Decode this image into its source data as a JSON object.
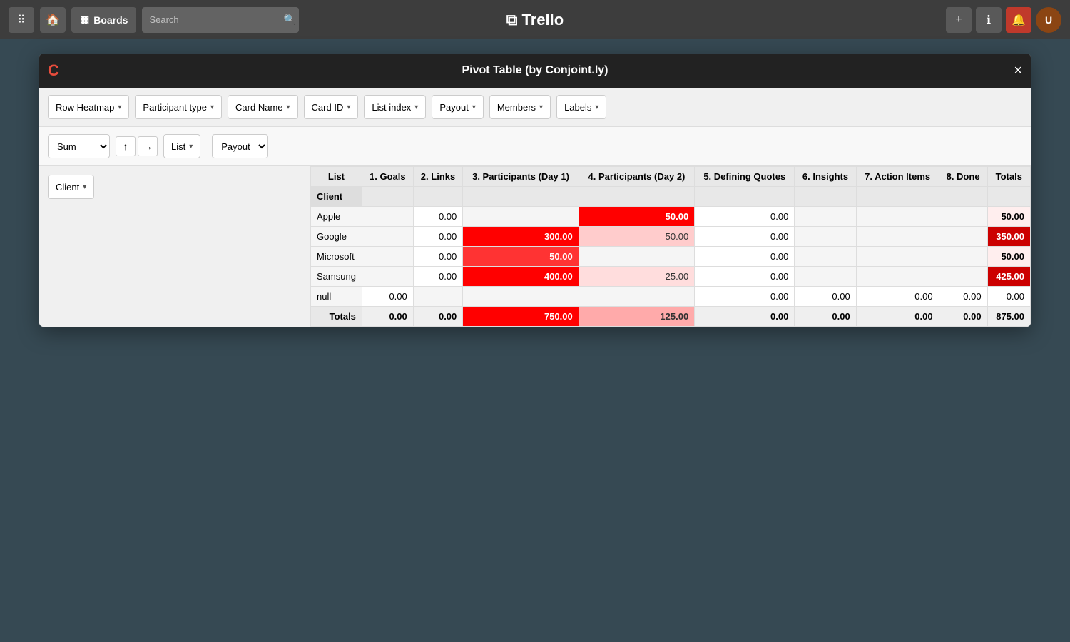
{
  "topNav": {
    "boards_label": "Boards",
    "search_placeholder": "Search",
    "logo_text": "Trello",
    "add_icon": "+",
    "info_icon": "ℹ",
    "bell_icon": "🔔",
    "avatar_text": "U"
  },
  "modal": {
    "title": "Pivot Table (by Conjoint.ly)",
    "close_label": "×",
    "logo_text": "C"
  },
  "filterBar": {
    "heatmap_label": "Row Heatmap",
    "participant_type_label": "Participant type",
    "card_name_label": "Card Name",
    "card_id_label": "Card ID",
    "list_index_label": "List index",
    "payout_label": "Payout",
    "members_label": "Members",
    "labels_label": "Labels"
  },
  "pivotControls": {
    "aggregate_label": "Sum",
    "rows_label": "List",
    "value_label": "Payout",
    "sort_up": "↑",
    "sort_right": "→"
  },
  "leftPanel": {
    "client_label": "Client"
  },
  "table": {
    "col_list": "List",
    "col_goals": "1. Goals",
    "col_links": "2. Links",
    "col_part_day1": "3. Participants (Day 1)",
    "col_part_day2": "4. Participants (Day 2)",
    "col_defining": "5. Defining Quotes",
    "col_insights": "6. Insights",
    "col_action": "7. Action Items",
    "col_done": "8. Done",
    "col_totals": "Totals",
    "rows": [
      {
        "client": "Apple",
        "goals": "",
        "links": "0.00",
        "part_day1": "",
        "part_day2": "50.00",
        "defining": "0.00",
        "insights": "",
        "action": "",
        "done": "",
        "total": "50.00",
        "heat_day1": "none",
        "heat_day2": "red-dark",
        "heat_total": "light"
      },
      {
        "client": "Google",
        "goals": "",
        "links": "0.00",
        "part_day1": "300.00",
        "part_day2": "50.00",
        "defining": "0.00",
        "insights": "",
        "action": "",
        "done": "",
        "total": "350.00",
        "heat_day1": "red-max",
        "heat_day2": "red-light",
        "heat_total": "strong"
      },
      {
        "client": "Microsoft",
        "goals": "",
        "links": "0.00",
        "part_day1": "50.00",
        "part_day2": "",
        "defining": "0.00",
        "insights": "",
        "action": "",
        "done": "",
        "total": "50.00",
        "heat_day1": "red-medium",
        "heat_day2": "none",
        "heat_total": "light"
      },
      {
        "client": "Samsung",
        "goals": "",
        "links": "0.00",
        "part_day1": "400.00",
        "part_day2": "25.00",
        "defining": "0.00",
        "insights": "",
        "action": "",
        "done": "",
        "total": "425.00",
        "heat_day1": "red-dark",
        "heat_day2": "red-very-light",
        "heat_total": "strong"
      },
      {
        "client": "null",
        "goals": "0.00",
        "links": "",
        "part_day1": "",
        "part_day2": "",
        "defining": "0.00",
        "insights": "0.00",
        "action": "0.00",
        "done": "0.00",
        "total": "0.00",
        "heat_day1": "none",
        "heat_day2": "none",
        "heat_total": "none"
      }
    ],
    "totals": {
      "label": "Totals",
      "goals": "0.00",
      "links": "0.00",
      "part_day1": "750.00",
      "part_day2": "125.00",
      "defining": "0.00",
      "insights": "0.00",
      "action": "0.00",
      "done": "0.00",
      "total": "875.00"
    }
  }
}
